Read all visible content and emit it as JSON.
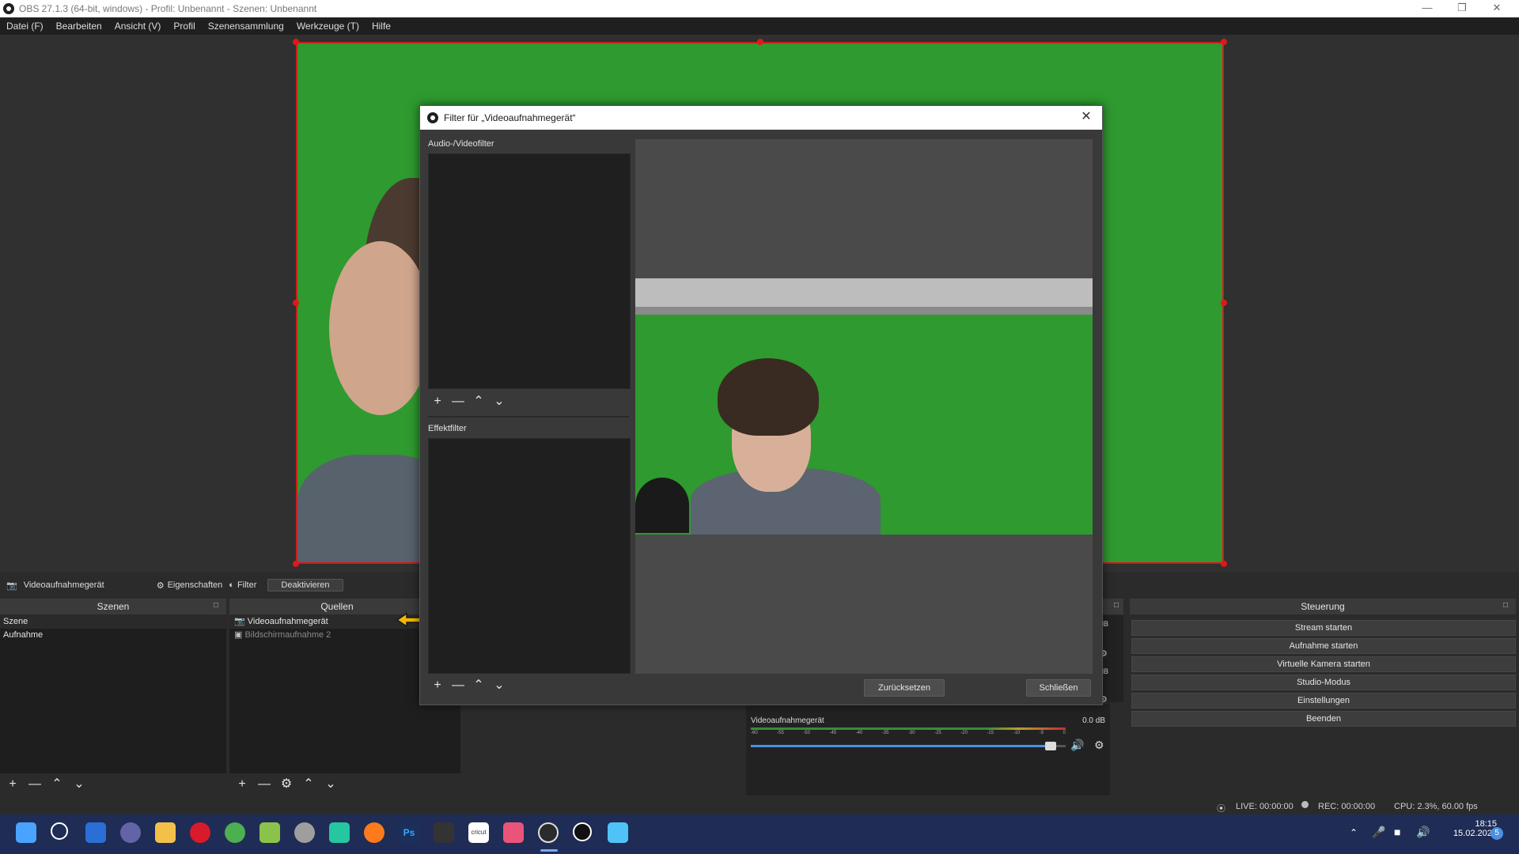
{
  "window": {
    "title": "OBS 27.1.3 (64-bit, windows) - Profil: Unbenannt - Szenen: Unbenannt"
  },
  "menu": [
    "Datei (F)",
    "Bearbeiten",
    "Ansicht (V)",
    "Profil",
    "Szenensammlung",
    "Werkzeuge (T)",
    "Hilfe"
  ],
  "dialog": {
    "title": "Filter für „Videoaufnahmegerät“",
    "audio_video_label": "Audio-/Videofilter",
    "effect_label": "Effektfilter",
    "reset_button": "Zurücksetzen",
    "close_button": "Schließen"
  },
  "source_toolbar": {
    "source_name": "Videoaufnahmegerät",
    "properties": "Eigenschaften",
    "filter": "Filter",
    "deactivate": "Deaktivieren"
  },
  "scenes": {
    "title": "Szenen",
    "items": [
      "Szene",
      "Aufnahme"
    ]
  },
  "sources": {
    "title": "Quellen",
    "items": [
      "Videoaufnahmegerät",
      "Bildschirmaufnahme 2"
    ]
  },
  "mixer": {
    "track_name": "Videoaufnahmegerät",
    "level": "0.0 dB",
    "side_db_1": "dB",
    "side_db_2": "dB",
    "ticks": [
      "-60",
      "-55",
      "-50",
      "-45",
      "-40",
      "-35",
      "-30",
      "-25",
      "-20",
      "-15",
      "-10",
      "-5",
      "0"
    ],
    "volume_fraction": 0.97
  },
  "controls": {
    "title": "Steuerung",
    "buttons": [
      "Stream starten",
      "Aufnahme starten",
      "Virtuelle Kamera starten",
      "Studio-Modus",
      "Einstellungen",
      "Beenden"
    ]
  },
  "status": {
    "live": "LIVE: 00:00:00",
    "rec": "REC: 00:00:00",
    "cpu": "CPU: 2.3%, 60.00 fps"
  },
  "taskbar": {
    "time": "18:15",
    "date": "15.02.2022",
    "notifications": "5",
    "ps_label": "Ps",
    "cricut_label": "cricut",
    "apps": [
      "windows-start",
      "search",
      "task-view",
      "teams-chat",
      "file-explorer",
      "opera",
      "chrome",
      "app-green",
      "app-rocket",
      "app-android",
      "firefox",
      "photoshop",
      "app-dark",
      "cricut",
      "app-pink",
      "obs",
      "app-circle",
      "notepad"
    ],
    "colors": {
      "start": "#4aa3ff",
      "explorer": "#f3c14a",
      "opera": "#d91a2a",
      "chrome": "#4caf50",
      "firefox": "#ff7a1a",
      "ps": "#1b2f5b",
      "teams": "#6264a7"
    }
  }
}
